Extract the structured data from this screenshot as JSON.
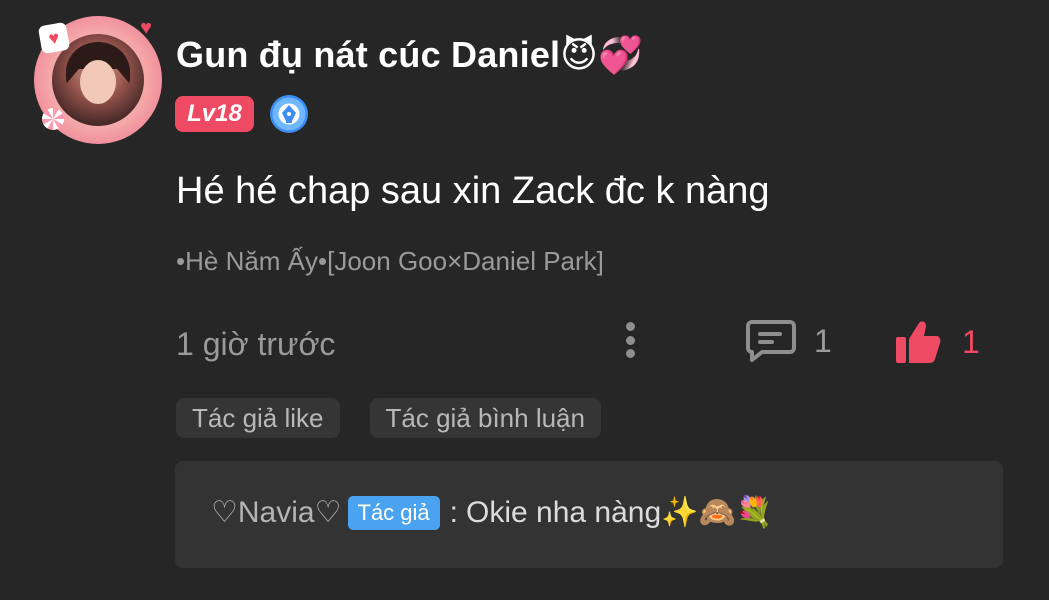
{
  "comment": {
    "username": "Gun đụ nát cúc Daniel😈💞",
    "level": "Lv18",
    "text": "Hé hé chap sau xin Zack đc k nàng",
    "story_title": "•Hè Năm Ấy•[Joon Goo×Daniel Park]",
    "time": "1 giờ trước",
    "reply_count": "1",
    "like_count": "1",
    "liked": true
  },
  "tags": [
    {
      "label": "Tác giả like"
    },
    {
      "label": "Tác giả bình luận"
    }
  ],
  "reply": {
    "author": "♡Navia♡",
    "author_tag": "Tác giả",
    "separator": ":",
    "text": "Okie nha nàng✨🙈💐"
  },
  "colors": {
    "background": "#262626",
    "accent": "#ef4a63",
    "author_tag": "#4aa3f0",
    "muted_text": "#9a9a9a",
    "reply_box": "#333333"
  },
  "icons": {
    "avatar": "avatar-icon",
    "pen_badge": "pen-nib-badge-icon",
    "more": "more-vertical-icon",
    "reply": "comment-bubble-icon",
    "like": "thumbs-up-icon"
  }
}
